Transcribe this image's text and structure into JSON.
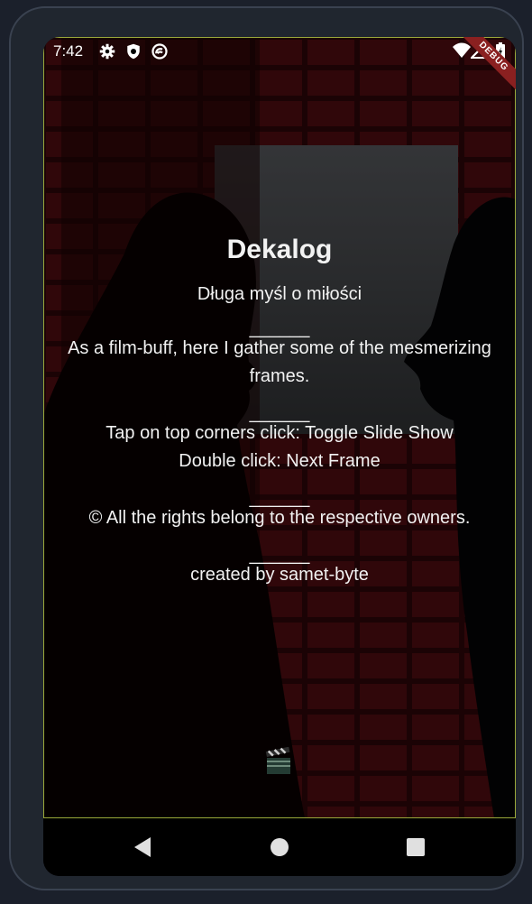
{
  "status_bar": {
    "time": "7:42",
    "left_icons": [
      "gear-icon",
      "shield-icon",
      "sync-icon"
    ],
    "right_icons": [
      "wifi-icon",
      "signal-icon",
      "battery-icon"
    ]
  },
  "debug_banner": "DEBUG",
  "main": {
    "title": "Dekalog",
    "subtitle": "Długa myśl o miłości",
    "separator": "______",
    "about": "As a film-buff, here I gather some of the mesmerizing frames.",
    "instructions_1": "Tap on top corners click: Toggle Slide Show",
    "instructions_2": "Double click: Next Frame",
    "rights": "© All the rights belong to the respective owners.",
    "credit": "created by samet-byte",
    "bottom_icon": "clapperboard-icon"
  },
  "nav_bar": {
    "back": "back-icon",
    "home": "home-icon",
    "recents": "recents-icon"
  },
  "colors": {
    "text": "#f2f2f2",
    "debug_outline": "#9aa83a",
    "debug_ribbon": "#8a2020",
    "device_frame": "#20262f"
  }
}
